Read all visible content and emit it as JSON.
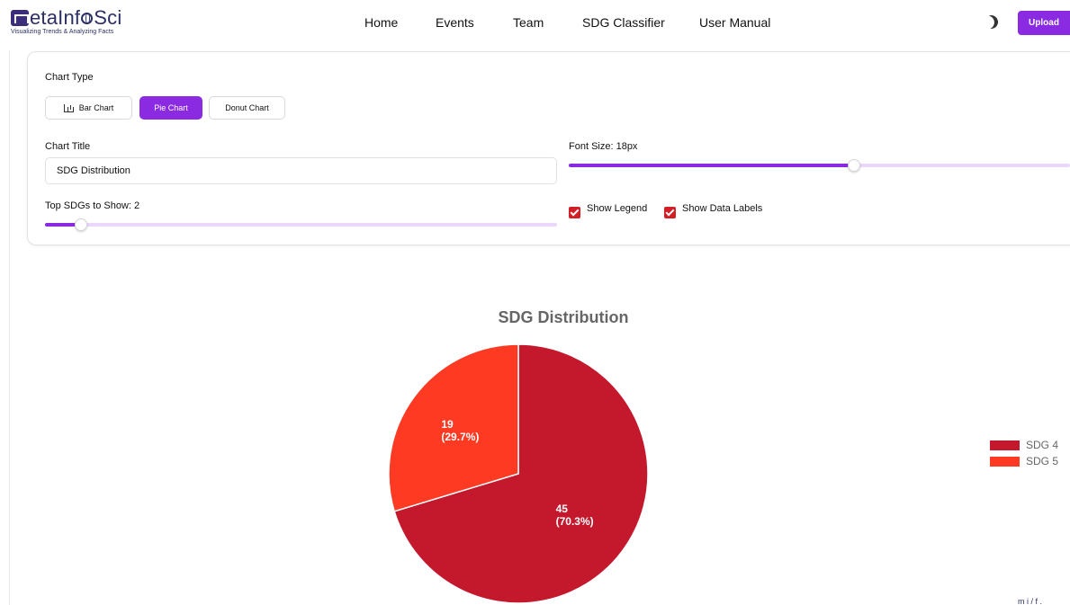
{
  "header": {
    "logo_name": "MetaInfoSci",
    "logo_tagline": "Visualizing Trends & Analyzing Facts",
    "nav": [
      "Home",
      "Events",
      "Team",
      "SDG Classifier",
      "User Manual"
    ],
    "theme_icon": "moon-icon",
    "upload_label": "Upload"
  },
  "controls": {
    "chart_type_label": "Chart Type",
    "chart_types": [
      {
        "label": "Bar Chart",
        "icon": "bar-chart-icon",
        "selected": false
      },
      {
        "label": "Pie Chart",
        "selected": true
      },
      {
        "label": "Donut Chart",
        "selected": false
      }
    ],
    "chart_title_label": "Chart Title",
    "chart_title_value": "SDG Distribution",
    "font_size_label": "Font Size: 18px",
    "font_size_value": 18,
    "font_size_fraction": 0.57,
    "top_sdgs_label": "Top SDGs to Show: 2",
    "top_sdgs_value": 2,
    "top_sdgs_fraction": 0.07,
    "show_legend_label": "Show Legend",
    "show_legend": true,
    "show_data_labels_label": "Show Data Labels",
    "show_data_labels": true
  },
  "chart_data": {
    "type": "pie",
    "title": "SDG Distribution",
    "categories": [
      "SDG 4",
      "SDG 5"
    ],
    "values": [
      45,
      19
    ],
    "percent_labels": [
      "(70.3%)",
      "(29.7%)"
    ],
    "colors": [
      "#c4182d",
      "#ff3a22"
    ],
    "legend_position": "right"
  },
  "colors": {
    "accent": "#8a2be2",
    "slider_track": "#ead7fb",
    "checkbox": "#d21f26"
  },
  "corner_mark": "m i / f ."
}
